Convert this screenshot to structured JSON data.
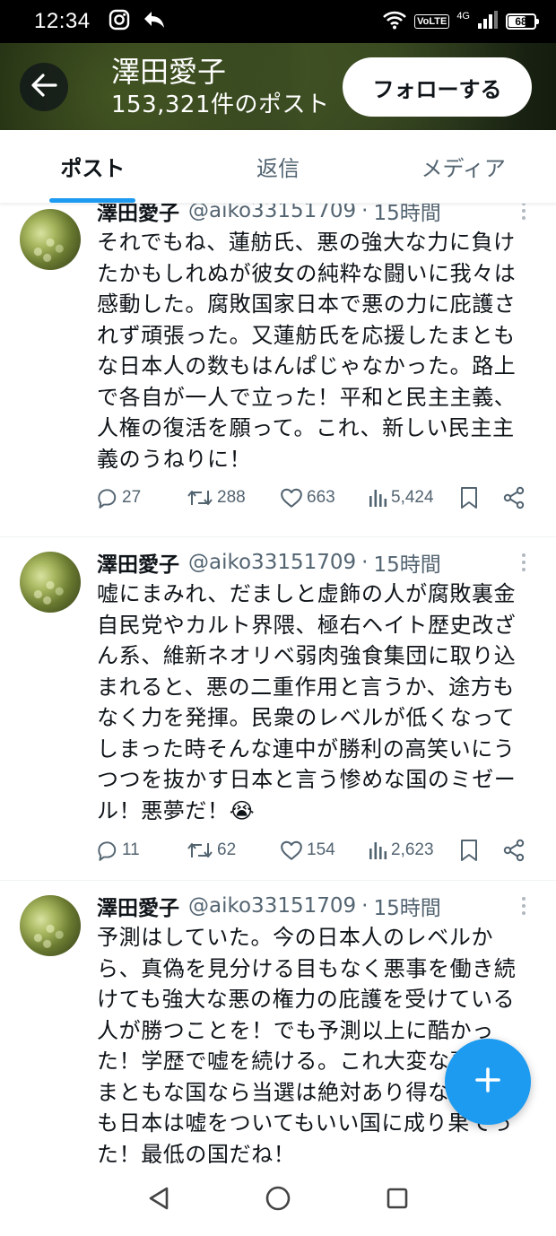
{
  "status_bar": {
    "time": "12:34",
    "network": "4G",
    "volte": "VoLTE",
    "battery": "68",
    "battery_level": 0.68
  },
  "header": {
    "name": "澤田愛子",
    "post_count": "153,321件のポスト",
    "follow_label": "フォローする"
  },
  "tabs": [
    {
      "label": "ポスト",
      "active": true
    },
    {
      "label": "返信",
      "active": false
    },
    {
      "label": "メディア",
      "active": false
    }
  ],
  "tweets": [
    {
      "name": "澤田愛子",
      "handle": "@aiko33151709",
      "separator": "·",
      "time": "15時間",
      "lines": [
        "それでもね、蓮舫氏、悪の強大な力に負け",
        "たかもしれぬが彼女の純粋な闘いに我々は",
        "感動した。腐敗国家日本で悪の力に庇護さ",
        "れず頑張った。又蓮舫氏を応援したまとも",
        "な日本人の数もはんぱじゃなかった。路上",
        "で各自が一人で立った！平和と民主主義、",
        "人権の復活を願って。これ、新しい民主主",
        "義のうねりに！"
      ],
      "replies": "27",
      "reposts": "288",
      "likes": "663",
      "views": "5,424"
    },
    {
      "name": "澤田愛子",
      "handle": "@aiko33151709",
      "separator": "·",
      "time": "15時間",
      "lines": [
        "嘘にまみれ、だましと虚飾の人が腐敗裏金",
        "自民党やカルト界隈、極右ヘイト歴史改ざ",
        "ん系、維新ネオリベ弱肉強食集団に取り込",
        "まれると、悪の二重作用と言うか、途方も",
        "なく力を発揮。民衆のレベルが低くなって",
        "しまった時そんな連中が勝利の高笑いにう",
        "つつを抜かす日本と言う惨めな国のミゼー",
        "ル！悪夢だ！😭"
      ],
      "replies": "11",
      "reposts": "62",
      "likes": "154",
      "views": "2,623"
    },
    {
      "name": "澤田愛子",
      "handle": "@aiko33151709",
      "separator": "·",
      "time": "15時間",
      "lines": [
        "予測はしていた。今の日本人のレベルか",
        "ら、真偽を見分ける目もなく悪事を働き続",
        "けても強大な悪の権力の庇護を受けている",
        "人が勝つことを！でも予測以上に酷かっ",
        "た！学歴で嘘を続ける。これ大変な事だ！",
        "まともな国なら当選は絶対あり得ない。で",
        "も日本は嘘をついてもいい国に成り果てっ",
        "た！最低の国だね！"
      ]
    }
  ],
  "icons": {
    "back": "arrow-left-icon",
    "reply": "speech-bubble-icon",
    "repost": "repost-arrows-icon",
    "like": "heart-icon",
    "views": "bar-chart-icon",
    "bookmark": "bookmark-icon",
    "share": "share-icon",
    "compose": "plus-icon"
  },
  "colors": {
    "accent": "#1d9bf0",
    "text": "#0f1419",
    "secondary": "#536471"
  }
}
